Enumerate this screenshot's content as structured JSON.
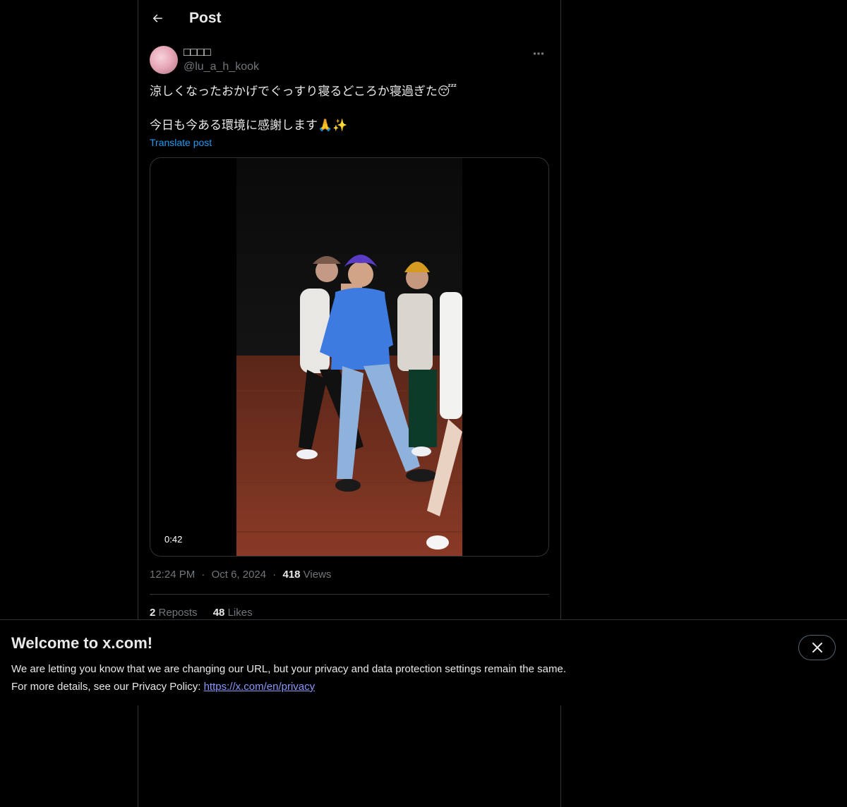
{
  "header": {
    "title": "Post",
    "back_icon": "arrow-left-icon"
  },
  "author": {
    "display_name": "□□□□",
    "handle": "@lu_a_h_kook",
    "more_icon": "more-horizontal-icon"
  },
  "post": {
    "line1": "涼しくなったおかげでぐっすり寝るどころか寝過ぎた😴",
    "line2": "今日も今ある環境に感謝します🙏✨",
    "translate_label": "Translate post"
  },
  "media": {
    "duration": "0:42"
  },
  "meta": {
    "time": "12:24 PM",
    "separator": "·",
    "date": "Oct 6, 2024",
    "views_count": "418",
    "views_label": "Views"
  },
  "stats": {
    "reposts_count": "2",
    "reposts_label": "Reposts",
    "likes_count": "48",
    "likes_label": "Likes"
  },
  "banner": {
    "title": "Welcome to x.com!",
    "line1": "We are letting you know that we are changing our URL, but your privacy and data protection settings remain the same.",
    "line2_prefix": "For more details, see our Privacy Policy: ",
    "link": "https://x.com/en/privacy",
    "close_icon": "close-icon"
  },
  "colors": {
    "background": "#000000",
    "text": "#e7e9ea",
    "muted": "#71767b",
    "accent": "#1d9bf0",
    "link": "#8b98f9"
  }
}
